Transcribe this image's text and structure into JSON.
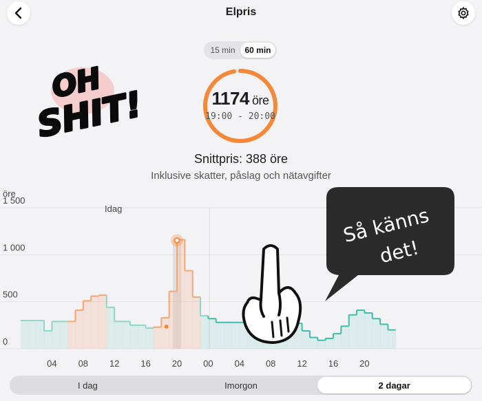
{
  "header": {
    "title": "Elpris",
    "back_icon": "chevron-left-icon",
    "settings_icon": "gear-icon"
  },
  "interval": {
    "options": [
      "15 min",
      "60 min"
    ],
    "selected": "60 min"
  },
  "current": {
    "price": "1174",
    "unit": "öre",
    "time": "19:00 - 20:00",
    "ring_fraction": 0.97,
    "ring_color": "#f5893a"
  },
  "summary": {
    "average": "Snittpris: 388 öre",
    "note": "Inklusive skatter, påslag och nätavgifter"
  },
  "sticker": {
    "text_line1": "OH",
    "text_line2": "SHIT!"
  },
  "bubble": {
    "line1": "Så känns",
    "line2": "det!"
  },
  "chart_data": {
    "type": "area",
    "ylabel": "öre",
    "ylim": [
      0,
      1500
    ],
    "yticks": [
      "1 500",
      "1 000",
      "500",
      "0"
    ],
    "ytick_values": [
      1500,
      1000,
      500,
      0
    ],
    "xticks": [
      "04",
      "08",
      "12",
      "16",
      "20",
      "00",
      "04",
      "08",
      "12",
      "16",
      "20"
    ],
    "day_label": "Idag",
    "highlight_hour": 19,
    "colors": {
      "past": "#8fd6c6",
      "peak": "#f4a672",
      "future": "#3bbfa6",
      "highlight": "#f5893a"
    },
    "hours": [
      0,
      1,
      2,
      3,
      4,
      5,
      6,
      7,
      8,
      9,
      10,
      11,
      12,
      13,
      14,
      15,
      16,
      17,
      18,
      19,
      20,
      21,
      22,
      23,
      24,
      25,
      26,
      27,
      28,
      29,
      30,
      31,
      32,
      33,
      34,
      35,
      36,
      37,
      38,
      39,
      40,
      41,
      42,
      43,
      44,
      45,
      46,
      47
    ],
    "values": [
      300,
      300,
      300,
      190,
      290,
      290,
      290,
      410,
      510,
      560,
      570,
      440,
      290,
      290,
      250,
      250,
      220,
      230,
      330,
      610,
      1160,
      830,
      550,
      350,
      320,
      280,
      280,
      280,
      280,
      280,
      280,
      280,
      320,
      340,
      340,
      270,
      190,
      120,
      90,
      110,
      160,
      240,
      360,
      410,
      380,
      320,
      260,
      200
    ]
  },
  "period": {
    "options": [
      "I dag",
      "Imorgon",
      "2 dagar"
    ],
    "selected": "2 dagar"
  }
}
